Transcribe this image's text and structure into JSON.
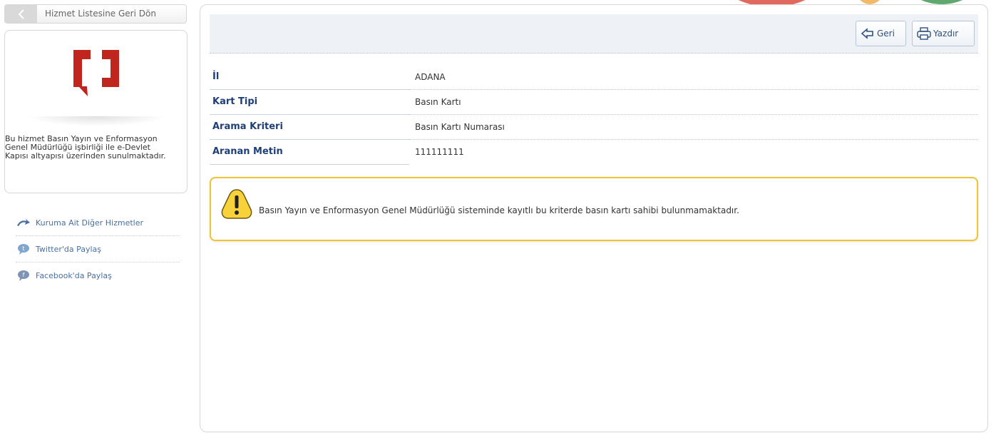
{
  "back_button": {
    "label": "Hizmet Listesine Geri Dön"
  },
  "info_panel": {
    "text": "Bu hizmet Basın Yayın ve Enformasyon Genel Müdürlüğü işbirliği ile e-Devlet Kapısı altyapısı üzerinden sunulmaktadır."
  },
  "side_links": [
    {
      "label": "Kuruma Ait Diğer Hizmetler",
      "icon": "arrow-icon"
    },
    {
      "label": "Twitter'da Paylaş",
      "icon": "twitter-icon"
    },
    {
      "label": "Facebook'da Paylaş",
      "icon": "facebook-icon"
    }
  ],
  "toolbar": {
    "back_label": "Geri",
    "print_label": "Yazdır"
  },
  "details": [
    {
      "key": "İl",
      "value": "ADANA"
    },
    {
      "key": "Kart Tipi",
      "value": "Basın Kartı"
    },
    {
      "key": "Arama Kriteri",
      "value": "Basın Kartı Numarası"
    },
    {
      "key": "Aranan Metin",
      "value": "111111111"
    }
  ],
  "alert": {
    "message": "Basın Yayın ve Enformasyon Genel Müdürlüğü sisteminde kayıtlı bu kriterde basın kartı sahibi bulunmamaktadır."
  },
  "colors": {
    "accent": "#1f3f77",
    "warning": "#f0c330",
    "logo": "#c0261e"
  }
}
